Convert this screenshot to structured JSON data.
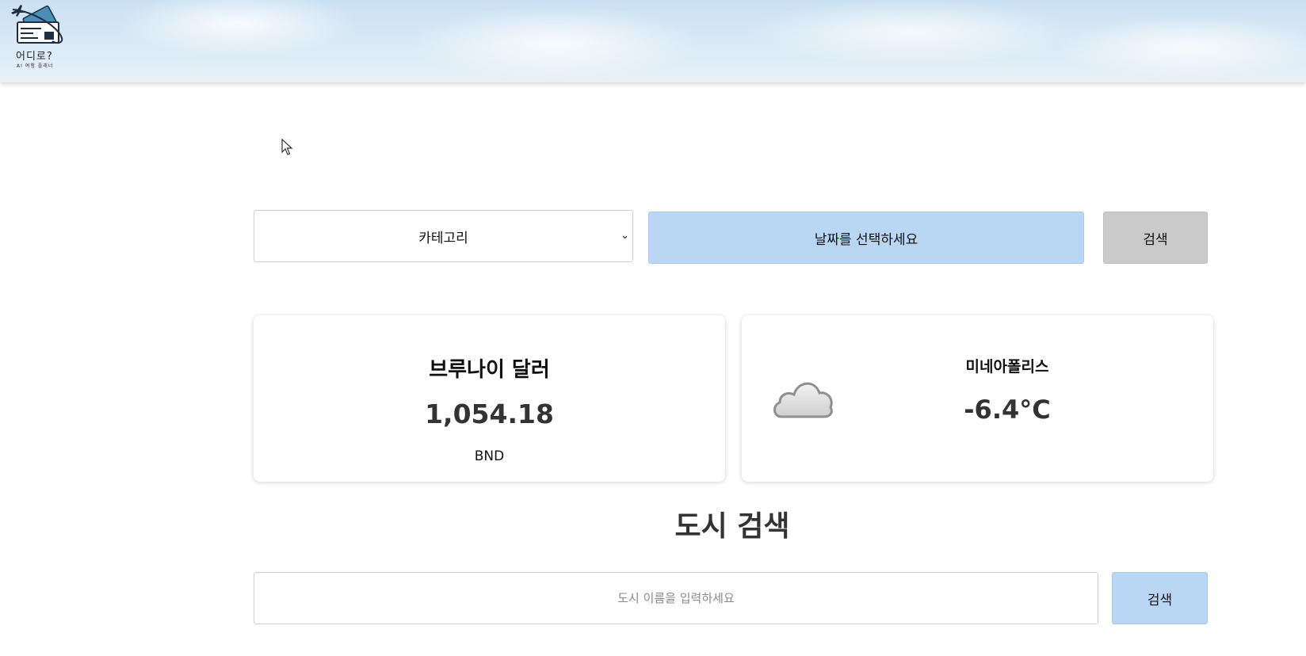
{
  "header": {
    "logo_title": "어디로?",
    "logo_subtitle": "AI 여행 플래너"
  },
  "filters": {
    "category_selected": "카테고리",
    "date_placeholder": "날짜를 선택하세요",
    "search_label": "검색"
  },
  "currency_card": {
    "name": "브루나이 달러",
    "value": "1,054.18",
    "code": "BND"
  },
  "weather_card": {
    "icon": "cloud-icon",
    "city": "미네아폴리스",
    "temperature": "-6.4°C"
  },
  "city_search": {
    "title": "도시 검색",
    "placeholder": "도시 이름을 입력하세요",
    "search_label": "검색"
  },
  "colors": {
    "accent_button": "#b9d7f5",
    "neutral_button": "#cacaca",
    "header_sky": "#c9e0f1"
  }
}
